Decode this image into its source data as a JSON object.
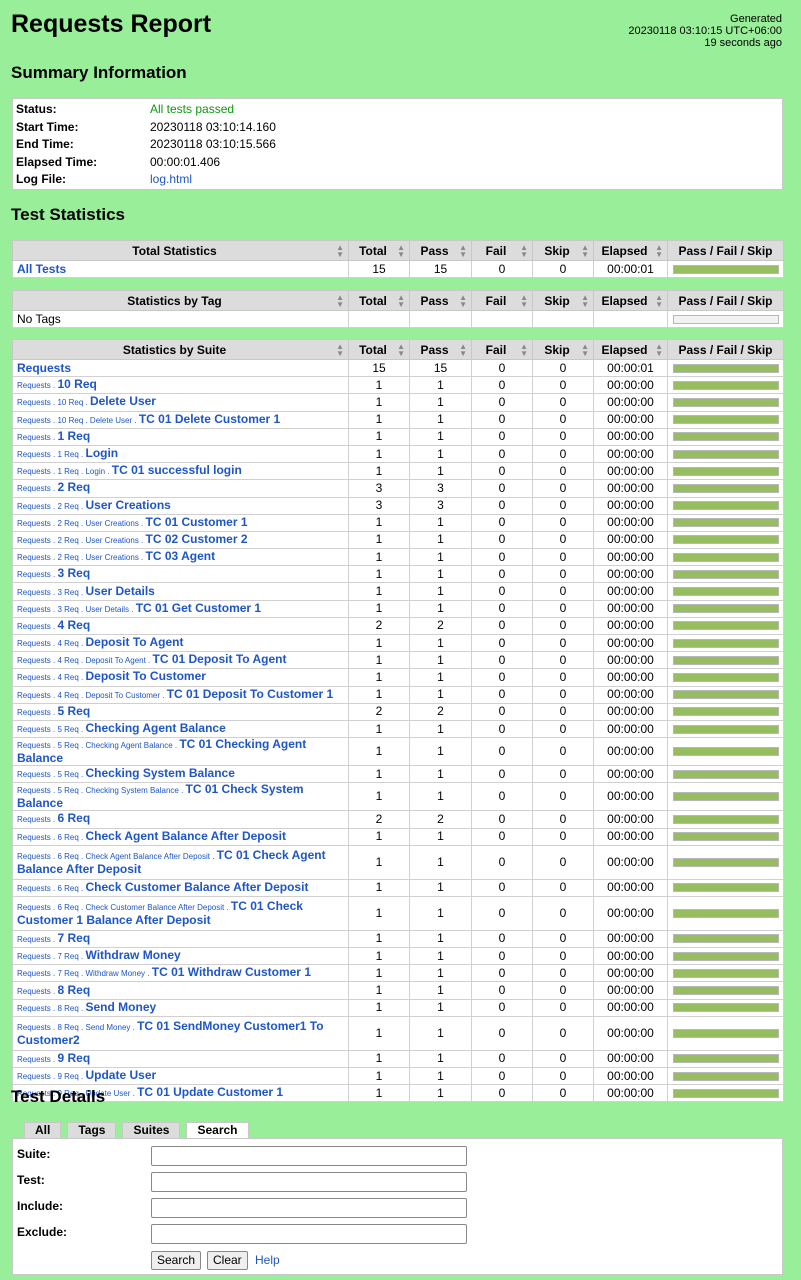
{
  "header": {
    "title": "Requests Report",
    "generated_label": "Generated",
    "generated_time": "20230118 03:10:15 UTC+06:00",
    "generated_ago": "19 seconds ago"
  },
  "summary": {
    "heading": "Summary Information",
    "rows": [
      {
        "key": "Status:",
        "value": "All tests passed"
      },
      {
        "key": "Start Time:",
        "value": "20230118 03:10:14.160"
      },
      {
        "key": "End Time:",
        "value": "20230118 03:10:15.566"
      },
      {
        "key": "Elapsed Time:",
        "value": "00:00:01.406"
      },
      {
        "key": "Log File:",
        "value": "log.html"
      }
    ]
  },
  "statistics": {
    "heading": "Test Statistics",
    "columns": [
      "Total",
      "Pass",
      "Fail",
      "Skip",
      "Elapsed",
      "Pass / Fail / Skip"
    ],
    "total_title": "Total Statistics",
    "tag_title": "Statistics by Tag",
    "suite_title": "Statistics by Suite",
    "total_rows": [
      {
        "pre": "",
        "name": "All Tests",
        "total": "15",
        "pass": "15",
        "fail": "0",
        "skip": "0",
        "elapsed": "00:00:01",
        "link": true
      }
    ],
    "tag_rows": [
      {
        "pre": "",
        "name": "No Tags",
        "total": "",
        "pass": "",
        "fail": "",
        "skip": "",
        "elapsed": "",
        "link": false
      }
    ],
    "suite_rows": [
      {
        "pre": "",
        "name": "Requests",
        "total": "15",
        "pass": "15",
        "fail": "0",
        "skip": "0",
        "elapsed": "00:00:01"
      },
      {
        "pre": "Requests . ",
        "name": "10 Req",
        "total": "1",
        "pass": "1",
        "fail": "0",
        "skip": "0",
        "elapsed": "00:00:00"
      },
      {
        "pre": "Requests . 10 Req . ",
        "name": "Delete User",
        "total": "1",
        "pass": "1",
        "fail": "0",
        "skip": "0",
        "elapsed": "00:00:00"
      },
      {
        "pre": "Requests . 10 Req . Delete User . ",
        "name": "TC 01 Delete Customer 1",
        "total": "1",
        "pass": "1",
        "fail": "0",
        "skip": "0",
        "elapsed": "00:00:00"
      },
      {
        "pre": "Requests . ",
        "name": "1 Req",
        "total": "1",
        "pass": "1",
        "fail": "0",
        "skip": "0",
        "elapsed": "00:00:00"
      },
      {
        "pre": "Requests . 1 Req . ",
        "name": "Login",
        "total": "1",
        "pass": "1",
        "fail": "0",
        "skip": "0",
        "elapsed": "00:00:00"
      },
      {
        "pre": "Requests . 1 Req . Login . ",
        "name": "TC 01 successful login",
        "total": "1",
        "pass": "1",
        "fail": "0",
        "skip": "0",
        "elapsed": "00:00:00"
      },
      {
        "pre": "Requests . ",
        "name": "2 Req",
        "total": "3",
        "pass": "3",
        "fail": "0",
        "skip": "0",
        "elapsed": "00:00:00"
      },
      {
        "pre": "Requests . 2 Req . ",
        "name": "User Creations",
        "total": "3",
        "pass": "3",
        "fail": "0",
        "skip": "0",
        "elapsed": "00:00:00"
      },
      {
        "pre": "Requests . 2 Req . User Creations . ",
        "name": "TC 01 Customer 1",
        "total": "1",
        "pass": "1",
        "fail": "0",
        "skip": "0",
        "elapsed": "00:00:00"
      },
      {
        "pre": "Requests . 2 Req . User Creations . ",
        "name": "TC 02 Customer 2",
        "total": "1",
        "pass": "1",
        "fail": "0",
        "skip": "0",
        "elapsed": "00:00:00"
      },
      {
        "pre": "Requests . 2 Req . User Creations . ",
        "name": "TC 03 Agent",
        "total": "1",
        "pass": "1",
        "fail": "0",
        "skip": "0",
        "elapsed": "00:00:00"
      },
      {
        "pre": "Requests . ",
        "name": "3 Req",
        "total": "1",
        "pass": "1",
        "fail": "0",
        "skip": "0",
        "elapsed": "00:00:00"
      },
      {
        "pre": "Requests . 3 Req . ",
        "name": "User Details",
        "total": "1",
        "pass": "1",
        "fail": "0",
        "skip": "0",
        "elapsed": "00:00:00"
      },
      {
        "pre": "Requests . 3 Req . User Details . ",
        "name": "TC 01 Get Customer 1",
        "total": "1",
        "pass": "1",
        "fail": "0",
        "skip": "0",
        "elapsed": "00:00:00"
      },
      {
        "pre": "Requests . ",
        "name": "4 Req",
        "total": "2",
        "pass": "2",
        "fail": "0",
        "skip": "0",
        "elapsed": "00:00:00"
      },
      {
        "pre": "Requests . 4 Req . ",
        "name": "Deposit To Agent",
        "total": "1",
        "pass": "1",
        "fail": "0",
        "skip": "0",
        "elapsed": "00:00:00"
      },
      {
        "pre": "Requests . 4 Req . Deposit To Agent . ",
        "name": "TC 01 Deposit To Agent",
        "total": "1",
        "pass": "1",
        "fail": "0",
        "skip": "0",
        "elapsed": "00:00:00"
      },
      {
        "pre": "Requests . 4 Req . ",
        "name": "Deposit To Customer",
        "total": "1",
        "pass": "1",
        "fail": "0",
        "skip": "0",
        "elapsed": "00:00:00"
      },
      {
        "pre": "Requests . 4 Req . Deposit To Customer . ",
        "name": "TC 01 Deposit To Customer 1",
        "total": "1",
        "pass": "1",
        "fail": "0",
        "skip": "0",
        "elapsed": "00:00:00"
      },
      {
        "pre": "Requests . ",
        "name": "5 Req",
        "total": "2",
        "pass": "2",
        "fail": "0",
        "skip": "0",
        "elapsed": "00:00:00"
      },
      {
        "pre": "Requests . 5 Req . ",
        "name": "Checking Agent Balance",
        "total": "1",
        "pass": "1",
        "fail": "0",
        "skip": "0",
        "elapsed": "00:00:00"
      },
      {
        "pre": "Requests . 5 Req . Checking Agent Balance . ",
        "name": "TC 01 Checking Agent Balance",
        "total": "1",
        "pass": "1",
        "fail": "0",
        "skip": "0",
        "elapsed": "00:00:00"
      },
      {
        "pre": "Requests . 5 Req . ",
        "name": "Checking System Balance",
        "total": "1",
        "pass": "1",
        "fail": "0",
        "skip": "0",
        "elapsed": "00:00:00"
      },
      {
        "pre": "Requests . 5 Req . Checking System Balance . ",
        "name": "TC 01 Check System Balance",
        "total": "1",
        "pass": "1",
        "fail": "0",
        "skip": "0",
        "elapsed": "00:00:00"
      },
      {
        "pre": "Requests . ",
        "name": "6 Req",
        "total": "2",
        "pass": "2",
        "fail": "0",
        "skip": "0",
        "elapsed": "00:00:00"
      },
      {
        "pre": "Requests . 6 Req . ",
        "name": "Check Agent Balance After Deposit",
        "total": "1",
        "pass": "1",
        "fail": "0",
        "skip": "0",
        "elapsed": "00:00:00"
      },
      {
        "pre": "Requests . 6 Req . Check Agent Balance After Deposit . ",
        "name": "TC 01 Check Agent Balance After Deposit",
        "total": "1",
        "pass": "1",
        "fail": "0",
        "skip": "0",
        "elapsed": "00:00:00",
        "tall": true
      },
      {
        "pre": "Requests . 6 Req . ",
        "name": "Check Customer Balance After Deposit",
        "total": "1",
        "pass": "1",
        "fail": "0",
        "skip": "0",
        "elapsed": "00:00:00"
      },
      {
        "pre": "Requests . 6 Req . Check Customer Balance After Deposit . ",
        "name": "TC 01 Check Customer 1 Balance After Deposit",
        "total": "1",
        "pass": "1",
        "fail": "0",
        "skip": "0",
        "elapsed": "00:00:00",
        "tall": true
      },
      {
        "pre": "Requests . ",
        "name": "7 Req",
        "total": "1",
        "pass": "1",
        "fail": "0",
        "skip": "0",
        "elapsed": "00:00:00"
      },
      {
        "pre": "Requests . 7 Req . ",
        "name": "Withdraw Money",
        "total": "1",
        "pass": "1",
        "fail": "0",
        "skip": "0",
        "elapsed": "00:00:00"
      },
      {
        "pre": "Requests . 7 Req . Withdraw Money . ",
        "name": "TC 01 Withdraw Customer 1",
        "total": "1",
        "pass": "1",
        "fail": "0",
        "skip": "0",
        "elapsed": "00:00:00"
      },
      {
        "pre": "Requests . ",
        "name": "8 Req",
        "total": "1",
        "pass": "1",
        "fail": "0",
        "skip": "0",
        "elapsed": "00:00:00"
      },
      {
        "pre": "Requests . 8 Req . ",
        "name": "Send Money",
        "total": "1",
        "pass": "1",
        "fail": "0",
        "skip": "0",
        "elapsed": "00:00:00"
      },
      {
        "pre": "Requests . 8 Req . Send Money . ",
        "name": "TC 01 SendMoney Customer1 To Customer2",
        "total": "1",
        "pass": "1",
        "fail": "0",
        "skip": "0",
        "elapsed": "00:00:00",
        "tall": true
      },
      {
        "pre": "Requests . ",
        "name": "9 Req",
        "total": "1",
        "pass": "1",
        "fail": "0",
        "skip": "0",
        "elapsed": "00:00:00"
      },
      {
        "pre": "Requests . 9 Req . ",
        "name": "Update User",
        "total": "1",
        "pass": "1",
        "fail": "0",
        "skip": "0",
        "elapsed": "00:00:00"
      },
      {
        "pre": "Requests . 9 Req . Update User . ",
        "name": "TC 01 Update Customer 1",
        "total": "1",
        "pass": "1",
        "fail": "0",
        "skip": "0",
        "elapsed": "00:00:00"
      }
    ]
  },
  "details": {
    "heading": "Test Details",
    "tabs": [
      "All",
      "Tags",
      "Suites",
      "Search"
    ],
    "active_tab": "Search",
    "fields": [
      {
        "label": "Suite:",
        "value": ""
      },
      {
        "label": "Test:",
        "value": ""
      },
      {
        "label": "Include:",
        "value": ""
      },
      {
        "label": "Exclude:",
        "value": ""
      }
    ],
    "search_label": "Search",
    "clear_label": "Clear",
    "help_label": "Help"
  },
  "colors": {
    "background": "#99ee99",
    "pass_bar": "#97bd61",
    "link": "#1e56c8",
    "pass_text": "#0b9a0b"
  }
}
